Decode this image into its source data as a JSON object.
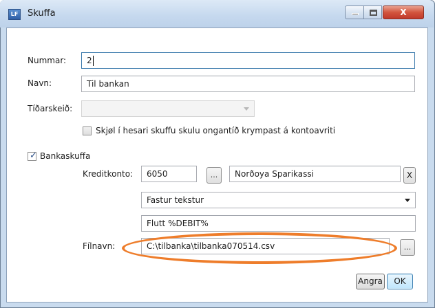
{
  "window": {
    "app_icon_text": "LF",
    "title": "Skuffa",
    "close_glyph": "X"
  },
  "form": {
    "nummar_label": "Nummar:",
    "nummar_value": "2",
    "navn_label": "Navn:",
    "navn_value": "Til bankan",
    "tidarskeid_label": "Tíðarskeið:",
    "tidarskeid_value": "",
    "no_shrink_checkbox_label": "Skjøl í hesari skuffu skulu ongantíð krympast á kontoavriti",
    "no_shrink_checked": false,
    "bankaskuffa_label": "Bankaskuffa",
    "bankaskuffa_checked": true,
    "kreditkonto_label": "Kreditkonto:",
    "kreditkonto_number": "6050",
    "browse_button_label": "...",
    "kreditkonto_name": "Norðoya Sparikassi",
    "clear_button_label": "X",
    "text_mode_value": "Fastur tekstur",
    "text_value": "Flutt %DEBIT%",
    "filnavn_label": "Fílnavn:",
    "filnavn_value": "C:\\tilbanka\\tilbanka070514.csv",
    "file_browse_button_label": "..."
  },
  "actions": {
    "cancel_label": "Angra",
    "ok_label": "OK"
  },
  "colors": {
    "highlight_oval": "#ee7d2b",
    "focus_border": "#3d7bad"
  }
}
